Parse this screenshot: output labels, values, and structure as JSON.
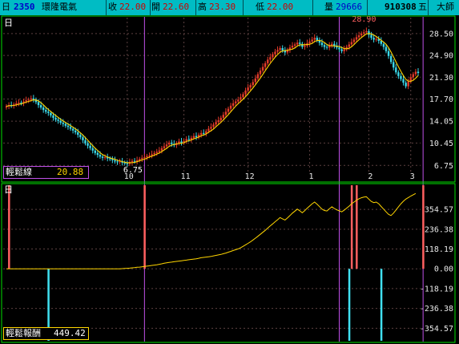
{
  "header": {
    "period_icon": "日",
    "code": "2350",
    "name": "環隆電氣",
    "close_label": "收",
    "close": "22.00",
    "open_label": "開",
    "open": "22.60",
    "high_label": "高",
    "high": "23.30",
    "low_label": "低",
    "low": "22.00",
    "volume_label": "量",
    "volume": "29666",
    "date": "910308",
    "tab1": "五",
    "tab2": "大師"
  },
  "colors": {
    "header_bg": "#00bcc4",
    "grid": "#5c4040",
    "up_candle": "#e23a2a",
    "down_candle": "#3ad8e8",
    "moving_average": "#ffd500",
    "panel_border": "#00e000",
    "marker_line": "#c050e8",
    "signal_up": "#ff6060",
    "signal_down": "#40e0f0",
    "axis_text": "#e8e8e8"
  },
  "chart_data": [
    {
      "type": "candlestick",
      "period": "日",
      "price_axis_ticks": [
        28.5,
        24.9,
        21.3,
        17.7,
        14.05,
        10.45,
        6.75
      ],
      "ylim": [
        5.6,
        30.2
      ],
      "month_labels": [
        "10",
        "11",
        "12",
        "1",
        "2",
        "3"
      ],
      "month_start_index": [
        49,
        72,
        98,
        123,
        147,
        164
      ],
      "marker_indices": [
        56,
        135,
        169
      ],
      "high_annotation": {
        "label": "28.90",
        "index": 147
      },
      "low_annotation": {
        "label": "6.75",
        "index": 50
      },
      "indicator_label": "輕鬆線",
      "indicator_value": "20.88",
      "closes": [
        16.5,
        16.7,
        16.6,
        16.8,
        17.0,
        17.1,
        17.0,
        17.3,
        17.5,
        17.6,
        17.8,
        17.6,
        17.2,
        16.7,
        16.3,
        15.9,
        15.6,
        15.4,
        15.0,
        14.6,
        14.3,
        14.1,
        13.8,
        13.6,
        13.3,
        13.1,
        12.8,
        12.5,
        12.2,
        11.8,
        11.4,
        10.9,
        10.4,
        10.0,
        9.6,
        9.2,
        8.8,
        8.5,
        8.2,
        8.0,
        8.1,
        7.9,
        7.8,
        7.6,
        7.4,
        7.3,
        7.4,
        7.2,
        7.1,
        7.0,
        7.3,
        7.5,
        7.4,
        7.6,
        7.8,
        8.0,
        8.1,
        8.3,
        8.4,
        8.6,
        8.8,
        9.0,
        9.2,
        9.6,
        9.9,
        10.2,
        10.5,
        10.3,
        10.1,
        10.4,
        10.7,
        10.5,
        10.8,
        11.1,
        11.0,
        11.3,
        11.6,
        11.4,
        11.8,
        12.1,
        12.0,
        12.4,
        12.8,
        13.1,
        13.5,
        13.9,
        14.2,
        14.6,
        15.1,
        15.6,
        16.1,
        16.6,
        17.0,
        17.3,
        17.6,
        18.0,
        18.5,
        19.1,
        19.6,
        20.0,
        20.5,
        21.1,
        21.8,
        22.4,
        23.0,
        23.6,
        24.2,
        24.6,
        25.1,
        25.5,
        25.8,
        26.1,
        25.7,
        25.4,
        25.8,
        26.2,
        26.5,
        26.7,
        27.0,
        26.8,
        26.3,
        26.5,
        26.9,
        27.2,
        27.5,
        27.8,
        27.4,
        27.0,
        26.6,
        26.3,
        26.2,
        26.5,
        26.8,
        26.5,
        26.2,
        25.9,
        25.6,
        25.9,
        26.3,
        26.7,
        27.1,
        27.5,
        27.9,
        28.2,
        28.5,
        28.7,
        28.9,
        28.3,
        27.8,
        27.5,
        27.6,
        27.3,
        26.8,
        26.3,
        25.6,
        24.8,
        23.8,
        22.9,
        22.1,
        21.5,
        21.0,
        20.4,
        19.8,
        20.6,
        21.3,
        21.8,
        22.2,
        22.0
      ]
    },
    {
      "type": "line",
      "period": "日",
      "y_axis_ticks": [
        354.57,
        236.38,
        118.19,
        0.0,
        -118.19,
        -236.38,
        -354.57
      ],
      "ylim": [
        -420,
        470
      ],
      "indicator_label": "輕鬆報酬",
      "indicator_value": "449.42",
      "values": [
        0,
        0,
        0,
        0,
        0,
        0,
        0,
        0,
        0,
        0,
        0,
        0,
        0,
        0,
        0,
        0,
        0,
        0,
        0,
        0,
        0,
        0,
        0,
        0,
        0,
        0,
        0,
        0,
        0,
        0,
        0,
        0,
        0,
        0,
        0,
        0,
        0,
        0,
        0,
        0,
        0,
        0,
        0,
        0,
        0,
        0,
        0,
        1,
        2,
        3,
        4,
        6,
        7,
        9,
        10,
        12,
        14,
        16,
        18,
        20,
        22,
        24,
        27,
        30,
        33,
        36,
        38,
        40,
        42,
        44,
        46,
        48,
        50,
        52,
        54,
        56,
        58,
        60,
        63,
        66,
        68,
        70,
        72,
        74,
        77,
        80,
        83,
        86,
        90,
        94,
        99,
        104,
        109,
        114,
        119,
        126,
        134,
        143,
        152,
        161,
        172,
        183,
        194,
        206,
        218,
        230,
        243,
        256,
        268,
        281,
        293,
        306,
        298,
        291,
        304,
        318,
        332,
        344,
        356,
        346,
        334,
        347,
        362,
        375,
        388,
        398,
        386,
        371,
        356,
        348,
        345,
        358,
        370,
        360,
        352,
        346,
        340,
        350,
        362,
        374,
        388,
        398,
        410,
        418,
        424,
        428,
        430,
        416,
        402,
        395,
        398,
        388,
        372,
        356,
        340,
        325,
        318,
        332,
        351,
        370,
        388,
        403,
        416,
        425,
        434,
        442,
        449.42
      ],
      "buy_signal_indices": [
        1,
        56,
        140,
        142,
        169
      ],
      "sell_signal_indices": [
        17,
        139,
        152
      ]
    }
  ]
}
